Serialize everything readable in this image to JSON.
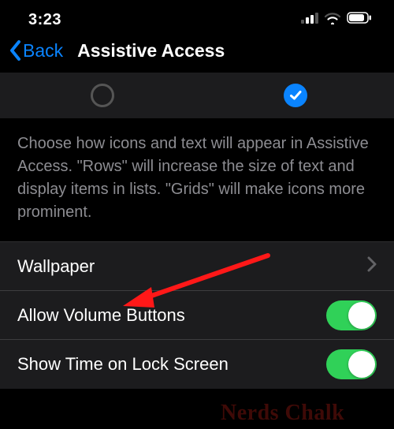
{
  "status": {
    "time": "3:23"
  },
  "nav": {
    "back_label": "Back",
    "title": "Assistive Access"
  },
  "description": "Choose how icons and text will appear in Assistive Access. \"Rows\" will increase the size of text and display items in lists. \"Grids\" will make icons more prominent.",
  "rows": {
    "wallpaper": {
      "label": "Wallpaper"
    },
    "volume": {
      "label": "Allow Volume Buttons",
      "on": true
    },
    "lock_time": {
      "label": "Show Time on Lock Screen",
      "on": true
    }
  },
  "watermark": "Nerds Chalk"
}
